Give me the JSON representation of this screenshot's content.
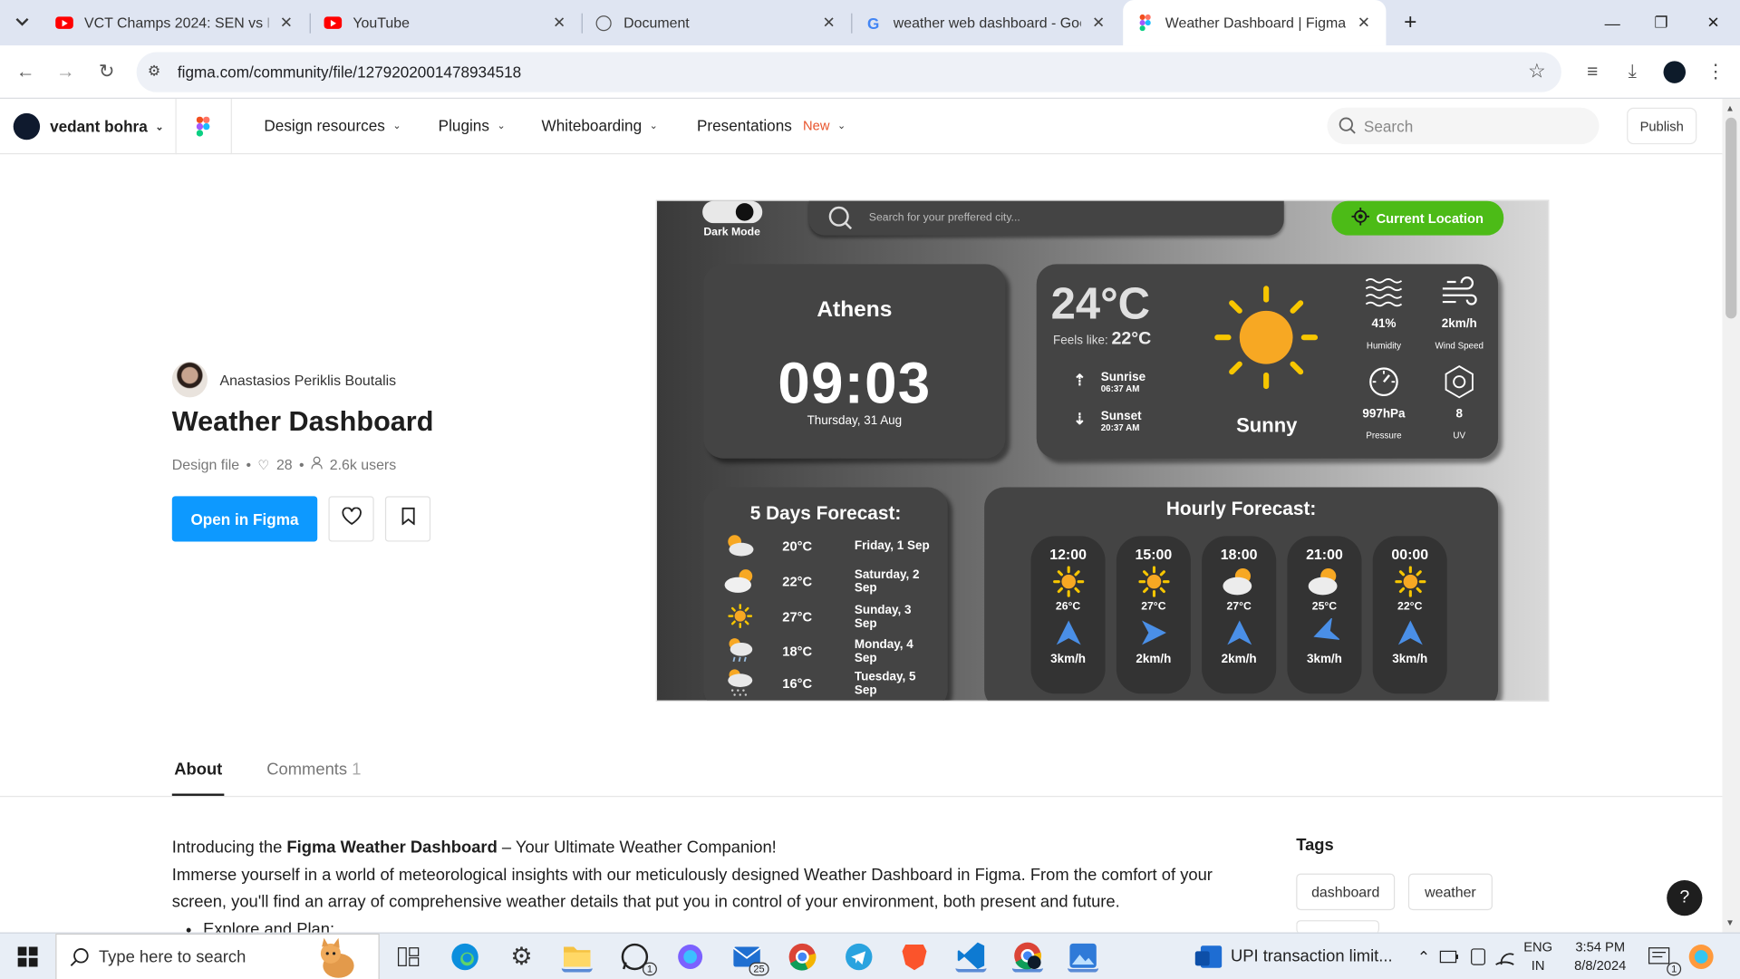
{
  "browser": {
    "tabs": [
      {
        "title": "VCT Champs 2024: SEN vs FPX (",
        "icon": "youtube-icon"
      },
      {
        "title": "YouTube",
        "icon": "youtube-icon"
      },
      {
        "title": "Document",
        "icon": "globe-icon"
      },
      {
        "title": "weather web dashboard - Goog",
        "icon": "google-icon"
      },
      {
        "title": "Weather Dashboard | Figma",
        "icon": "figma-icon",
        "active": true
      }
    ],
    "url": "figma.com/community/file/1279202001478934518"
  },
  "figma_header": {
    "user": "vedant bohra",
    "nav": [
      "Design resources",
      "Plugins",
      "Whiteboarding",
      "Presentations"
    ],
    "new_badge": "New",
    "search_placeholder": "Search",
    "publish": "Publish"
  },
  "file": {
    "author": "Anastasios Periklis Boutalis",
    "title": "Weather Dashboard",
    "type": "Design file",
    "likes": "28",
    "users": "2.6k users",
    "open_button": "Open in Figma"
  },
  "preview": {
    "dark_mode": "Dark Mode",
    "search_placeholder": "Search for your preffered city...",
    "current_location": "Current Location",
    "city": "Athens",
    "time": "09:03",
    "date": "Thursday, 31 Aug",
    "temp": "24°C",
    "feels_label": "Feels like:",
    "feels_value": "22°C",
    "sunrise_label": "Sunrise",
    "sunrise_time": "06:37 AM",
    "sunset_label": "Sunset",
    "sunset_time": "20:37 AM",
    "condition": "Sunny",
    "stats": [
      {
        "value": "41%",
        "label": "Humidity",
        "icon": "humidity-icon"
      },
      {
        "value": "2km/h",
        "label": "Wind Speed",
        "icon": "wind-icon"
      },
      {
        "value": "997hPa",
        "label": "Pressure",
        "icon": "pressure-icon"
      },
      {
        "value": "8",
        "label": "UV",
        "icon": "uv-icon"
      }
    ],
    "forecast_title": "5 Days Forecast:",
    "forecast": [
      {
        "temp": "20°C",
        "day": "Friday, 1 Sep",
        "icon": "partly-cloudy-icon"
      },
      {
        "temp": "22°C",
        "day": "Saturday, 2 Sep",
        "icon": "partly-cloudy-icon"
      },
      {
        "temp": "27°C",
        "day": "Sunday, 3 Sep",
        "icon": "sun-icon"
      },
      {
        "temp": "18°C",
        "day": "Monday, 4 Sep",
        "icon": "rain-icon"
      },
      {
        "temp": "16°C",
        "day": "Tuesday, 5 Sep",
        "icon": "drizzle-icon"
      }
    ],
    "hourly_title": "Hourly Forecast:",
    "hourly": [
      {
        "time": "12:00",
        "temp": "26°C",
        "wind": "3km/h",
        "icon": "sun-icon"
      },
      {
        "time": "15:00",
        "temp": "27°C",
        "wind": "2km/h",
        "icon": "sun-icon"
      },
      {
        "time": "18:00",
        "temp": "27°C",
        "wind": "2km/h",
        "icon": "partly-cloudy-icon"
      },
      {
        "time": "21:00",
        "temp": "25°C",
        "wind": "3km/h",
        "icon": "partly-cloudy-icon"
      },
      {
        "time": "00:00",
        "temp": "22°C",
        "wind": "3km/h",
        "icon": "sun-icon"
      }
    ]
  },
  "about": {
    "tab_about": "About",
    "tab_comments": "Comments",
    "comments_count": "1",
    "intro_pre": "Introducing the ",
    "intro_bold": "Figma Weather Dashboard",
    "intro_post": " – Your Ultimate Weather Companion!",
    "para": "Immerse yourself in a world of meteorological insights with our meticulously designed Weather Dashboard in Figma. From the comfort of your screen, you'll find an array of comprehensive weather details that put you in control of your environment, both present and future.",
    "bullet": "Explore and Plan:",
    "tags_title": "Tags",
    "tags": [
      "dashboard",
      "weather"
    ]
  },
  "taskbar": {
    "search_placeholder": "Type here to search",
    "notification": "UPI transaction limit...",
    "lang_1": "ENG",
    "lang_2": "IN",
    "time": "3:54 PM",
    "date": "8/8/2024",
    "whatsapp_badge": "1",
    "mail_badge": "25",
    "notif_badge": "1"
  },
  "colors": {
    "figma_blue": "#0d99ff",
    "location_green": "#4cbb17",
    "sun_orange": "#f7a823"
  }
}
